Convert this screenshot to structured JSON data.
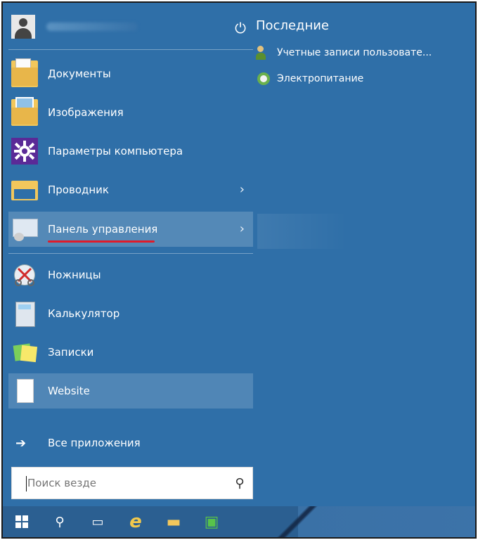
{
  "start_menu": {
    "user": {
      "name": ""
    },
    "left_items": [
      {
        "label": "Документы"
      },
      {
        "label": "Изображения"
      },
      {
        "label": "Параметры компьютера"
      },
      {
        "label": "Проводник",
        "chevron": "›"
      },
      {
        "label": "Панель управления",
        "chevron": "›"
      },
      {
        "label": "Ножницы"
      },
      {
        "label": "Калькулятор"
      },
      {
        "label": "Записки"
      },
      {
        "label": "Website"
      }
    ],
    "all_apps": {
      "label": "Все приложения",
      "arrow": "➔"
    },
    "search": {
      "placeholder": "Поиск везде",
      "icon": "⚲"
    },
    "right": {
      "power_icon": "⏻",
      "recent_title": "Последние",
      "recent_items": [
        {
          "label": "Учетные записи пользовате..."
        },
        {
          "label": "Электропитание"
        }
      ]
    }
  },
  "taskbar": {
    "search_icon": "⚲",
    "task_view_icon": "▭",
    "ie_icon": "e",
    "explorer_icon": "▬",
    "store_icon": "▣"
  },
  "colors": {
    "background": "#2f6fa8",
    "highlight": "#3f82bf",
    "accent_red": "#e01b2a",
    "taskbar": "#2b5f91"
  }
}
